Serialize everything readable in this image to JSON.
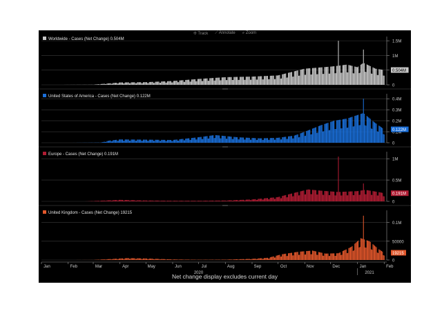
{
  "toolbar": {
    "track": "Track",
    "annotate": "Annotate",
    "zoom": "Zoom"
  },
  "footer": "Net change display excludes current day",
  "x_axis": {
    "months": [
      "Jan",
      "Feb",
      "Mar",
      "Apr",
      "May",
      "Jun",
      "Jul",
      "Aug",
      "Sep",
      "Oct",
      "Nov",
      "Dec",
      "Jan",
      "Feb"
    ],
    "year_labels": [
      "2020",
      "2021"
    ]
  },
  "chart_data": [
    {
      "type": "bar",
      "title": "Worldwide - Cases (Net Change) 0.504M",
      "color": "#c8c8c8",
      "x": [
        "2020-01-22",
        "2020-02-01",
        "2020-03-01",
        "2020-04-01",
        "2020-05-01",
        "2020-06-01",
        "2020-07-01",
        "2020-08-01",
        "2020-09-01",
        "2020-10-01",
        "2020-11-01",
        "2020-12-01",
        "2020-12-10",
        "2020-12-20",
        "2021-01-01",
        "2021-01-08",
        "2021-01-15",
        "2021-01-22",
        "2021-02-01"
      ],
      "values": [
        0.0,
        0.002,
        0.005,
        0.08,
        0.09,
        0.13,
        0.2,
        0.26,
        0.28,
        0.32,
        0.55,
        0.62,
        0.65,
        0.69,
        0.6,
        0.75,
        0.65,
        0.55,
        0.504
      ],
      "spikes": [
        {
          "x": "2020-12-10",
          "value": 1.5
        },
        {
          "x": "2021-01-08",
          "value": 1.2
        }
      ],
      "yticks": [
        0,
        0.5,
        1,
        1.5
      ],
      "ytick_labels": [
        "0",
        "0.5M",
        "1M",
        "1.5M"
      ],
      "ylim": [
        0,
        1.55
      ],
      "last_value_label": "0.504M"
    },
    {
      "type": "bar",
      "title": "United States of America - Cases (Net Change) 0.122M",
      "color": "#1a6ed8",
      "x": [
        "2020-01-22",
        "2020-02-01",
        "2020-03-10",
        "2020-03-20",
        "2020-04-01",
        "2020-05-01",
        "2020-06-01",
        "2020-07-01",
        "2020-07-20",
        "2020-08-15",
        "2020-09-10",
        "2020-10-01",
        "2020-10-20",
        "2020-11-01",
        "2020-11-20",
        "2020-12-05",
        "2020-12-20",
        "2021-01-08",
        "2021-01-20",
        "2021-02-01"
      ],
      "values": [
        0.0,
        0.0,
        0.002,
        0.02,
        0.03,
        0.028,
        0.025,
        0.05,
        0.07,
        0.05,
        0.04,
        0.045,
        0.065,
        0.1,
        0.16,
        0.2,
        0.22,
        0.27,
        0.19,
        0.122
      ],
      "spikes": [
        {
          "x": "2021-01-08",
          "value": 0.4
        }
      ],
      "yticks": [
        0,
        0.1,
        0.2,
        0.3,
        0.4
      ],
      "ytick_labels": [
        "0",
        "0.1M",
        "0.2M",
        "0.3M",
        "0.4M"
      ],
      "ylim": [
        0,
        0.42
      ],
      "last_value_label": "0.122M"
    },
    {
      "type": "bar",
      "title": "Europe - Cases (Net Change) 0.191M",
      "color": "#b01c33",
      "x": [
        "2020-01-22",
        "2020-02-20",
        "2020-03-15",
        "2020-04-01",
        "2020-05-01",
        "2020-06-01",
        "2020-07-01",
        "2020-08-01",
        "2020-09-01",
        "2020-10-01",
        "2020-10-20",
        "2020-11-05",
        "2020-11-20",
        "2020-12-10",
        "2021-01-01",
        "2021-01-10",
        "2021-01-25",
        "2021-02-01"
      ],
      "values": [
        0.0,
        0.0,
        0.02,
        0.035,
        0.02,
        0.015,
        0.015,
        0.02,
        0.045,
        0.1,
        0.2,
        0.28,
        0.25,
        0.22,
        0.24,
        0.27,
        0.22,
        0.191
      ],
      "spikes": [
        {
          "x": "2020-12-10",
          "value": 1.05
        },
        {
          "x": "2021-01-08",
          "value": 0.42
        }
      ],
      "yticks": [
        0,
        0.5,
        1
      ],
      "ytick_labels": [
        "0",
        "0.5M",
        "1M"
      ],
      "ylim": [
        0,
        1.1
      ],
      "last_value_label": "0.191M"
    },
    {
      "type": "bar",
      "title": "United Kingdom - Cases (Net Change) 19215",
      "color": "#e2572b",
      "x": [
        "2020-01-22",
        "2020-03-01",
        "2020-03-25",
        "2020-04-10",
        "2020-05-01",
        "2020-06-01",
        "2020-07-01",
        "2020-08-01",
        "2020-09-01",
        "2020-09-20",
        "2020-10-05",
        "2020-10-25",
        "2020-11-10",
        "2020-11-25",
        "2020-12-10",
        "2020-12-25",
        "2021-01-05",
        "2021-01-15",
        "2021-01-25",
        "2021-02-01"
      ],
      "values": [
        0,
        200,
        3000,
        5000,
        4000,
        1500,
        700,
        1000,
        3000,
        6000,
        15000,
        22000,
        25000,
        17000,
        18000,
        35000,
        58000,
        50000,
        30000,
        19215
      ],
      "spikes": [
        {
          "x": "2021-01-08",
          "value": 118000
        }
      ],
      "yticks": [
        0,
        50000,
        100000
      ],
      "ytick_labels": [
        "0",
        "50000",
        "0.1M"
      ],
      "ylim": [
        0,
        125000
      ],
      "last_value_label": "19215"
    }
  ]
}
